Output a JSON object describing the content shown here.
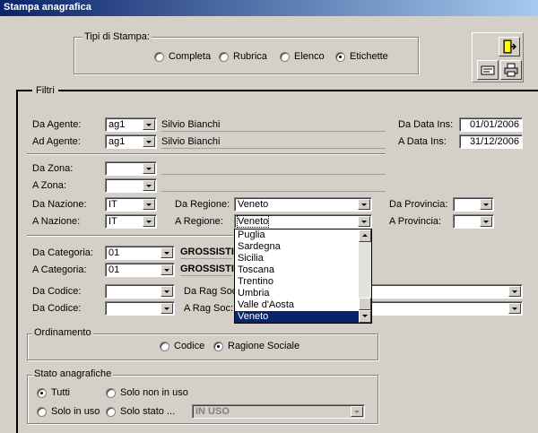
{
  "window": {
    "title": "Stampa anagrafica"
  },
  "tipi_stampa": {
    "legend": "Tipi di Stampa:",
    "options": [
      "Completa",
      "Rubrica",
      "Elenco",
      "Etichette"
    ],
    "selected": 3
  },
  "toolbar": {
    "exit_icon": "door-exit-icon",
    "preview_icon": "preview-icon",
    "print_icon": "printer-icon"
  },
  "filtri": {
    "tab_label": "Filtri",
    "da_agente": {
      "label": "Da Agente:",
      "code": "ag1",
      "name": "Silvio Bianchi"
    },
    "ad_agente": {
      "label": "Ad Agente:",
      "code": "ag1",
      "name": "Silvio Bianchi"
    },
    "da_data_ins": {
      "label": "Da Data Ins:",
      "value": "01/01/2006"
    },
    "a_data_ins": {
      "label": "A Data Ins:",
      "value": "31/12/2006"
    },
    "da_zona": {
      "label": "Da Zona:",
      "value": ""
    },
    "a_zona": {
      "label": "A Zona:",
      "value": ""
    },
    "da_nazione": {
      "label": "Da Nazione:",
      "value": "IT"
    },
    "a_nazione": {
      "label": "A Nazione:",
      "value": "IT"
    },
    "da_regione": {
      "label": "Da Regione:",
      "value": "Veneto"
    },
    "a_regione": {
      "label": "A Regione:",
      "value": "Veneto"
    },
    "da_provincia": {
      "label": "Da Provincia:",
      "value": ""
    },
    "a_provincia": {
      "label": "A Provincia:",
      "value": ""
    },
    "da_categoria": {
      "label": "Da Categoria:",
      "code": "01",
      "name": "GROSSISTI"
    },
    "a_categoria": {
      "label": "A Categoria:",
      "code": "01",
      "name": "GROSSISTI"
    },
    "da_codice_1": {
      "label": "Da Codice:",
      "value": ""
    },
    "da_codice_2": {
      "label": "Da Codice:",
      "value": ""
    },
    "da_rag_soc": {
      "label": "Da Rag Soc",
      "value": ""
    },
    "a_rag_soc": {
      "label": "A Rag Soc:",
      "value": ""
    }
  },
  "regione_dropdown": {
    "items": [
      "Puglia",
      "Sardegna",
      "Sicilia",
      "Toscana",
      "Trentino",
      "Umbria",
      "Valle d'Aosta",
      "Veneto"
    ],
    "selected": 7
  },
  "ordinamento": {
    "legend": "Ordinamento",
    "options": [
      "Codice",
      "Ragione Sociale"
    ],
    "selected": 1
  },
  "stato": {
    "legend": "Stato anagrafiche",
    "options": [
      "Tutti",
      "Solo non in uso",
      "Solo in uso",
      "Solo stato ..."
    ],
    "selected": 0,
    "stato_value": "IN USO"
  }
}
